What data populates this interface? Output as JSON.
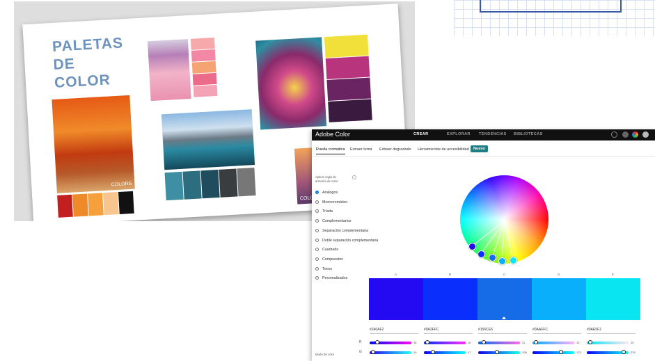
{
  "collage": {
    "title_lines": [
      "PALETAS",
      "DE",
      "COLOR"
    ],
    "photo_tag_text": "COLORS",
    "photo_tag_text2": "COLORS",
    "palettes": {
      "autumn": [
        "#c41f1f",
        "#ef8a2b",
        "#f5a03c",
        "#f7c58d",
        "#111111"
      ],
      "hat": [
        "#f7a8ab",
        "#f288a4",
        "#f5a373",
        "#ed6b8a",
        "#f4a3b6"
      ],
      "flower": [
        "#f1e03a",
        "#b8357d",
        "#6a2461",
        "#3a1a3f"
      ],
      "lake": [
        "#3f8fa4",
        "#2d6d80",
        "#1f4d5d",
        "#3a3d3f",
        "#777777"
      ]
    }
  },
  "app": {
    "name": "Adobe Color",
    "nav": [
      "CREAR",
      "EXPLORAR",
      "TENDENCIAS",
      "BIBLIOTECAS"
    ],
    "top_icons": [
      {
        "name": "settings-icon",
        "color": "#888888"
      },
      {
        "name": "app-switcher-icon",
        "color": "#999999"
      },
      {
        "name": "color-wheel-icon",
        "color": "#f0a020"
      },
      {
        "name": "help-icon",
        "color": "#bbbbbb"
      }
    ],
    "tabs": [
      "Rueda cromática",
      "Extraer tema",
      "Extraer degradado",
      "Herramientas de accesibilidad",
      "Nuevo"
    ],
    "rule_label": "Aplicar regla de armonía de color",
    "harmony_rules": [
      "Análogos",
      "Monocromático",
      "Tríada",
      "Complementarios",
      "Separación complementaria",
      "Doble separación complementaria",
      "Cuadrado",
      "Compuestos",
      "Tonos",
      "Personalizados"
    ],
    "selected_rule": "Análogos",
    "mode_label": "Modo de color",
    "swatches": [
      {
        "letter": "A",
        "hex": "#240AF2",
        "color": "#240af2",
        "r": 36,
        "g": 10,
        "b": 242
      },
      {
        "letter": "B",
        "hex": "#0A2FFC",
        "color": "#0a2ffc",
        "r": 10,
        "g": 47,
        "b": 252
      },
      {
        "letter": "C",
        "hex": "#156CE6",
        "color": "#156ce6",
        "r": 21,
        "g": 108,
        "b": 230,
        "base": true
      },
      {
        "letter": "D",
        "hex": "#0AAFFC",
        "color": "#0aaffc",
        "r": 10,
        "g": 175,
        "b": 252
      },
      {
        "letter": "E",
        "hex": "#0AE5F2",
        "color": "#0ae5f2",
        "r": 10,
        "g": 229,
        "b": 242
      }
    ],
    "channel_labels": [
      "R",
      "G"
    ]
  }
}
